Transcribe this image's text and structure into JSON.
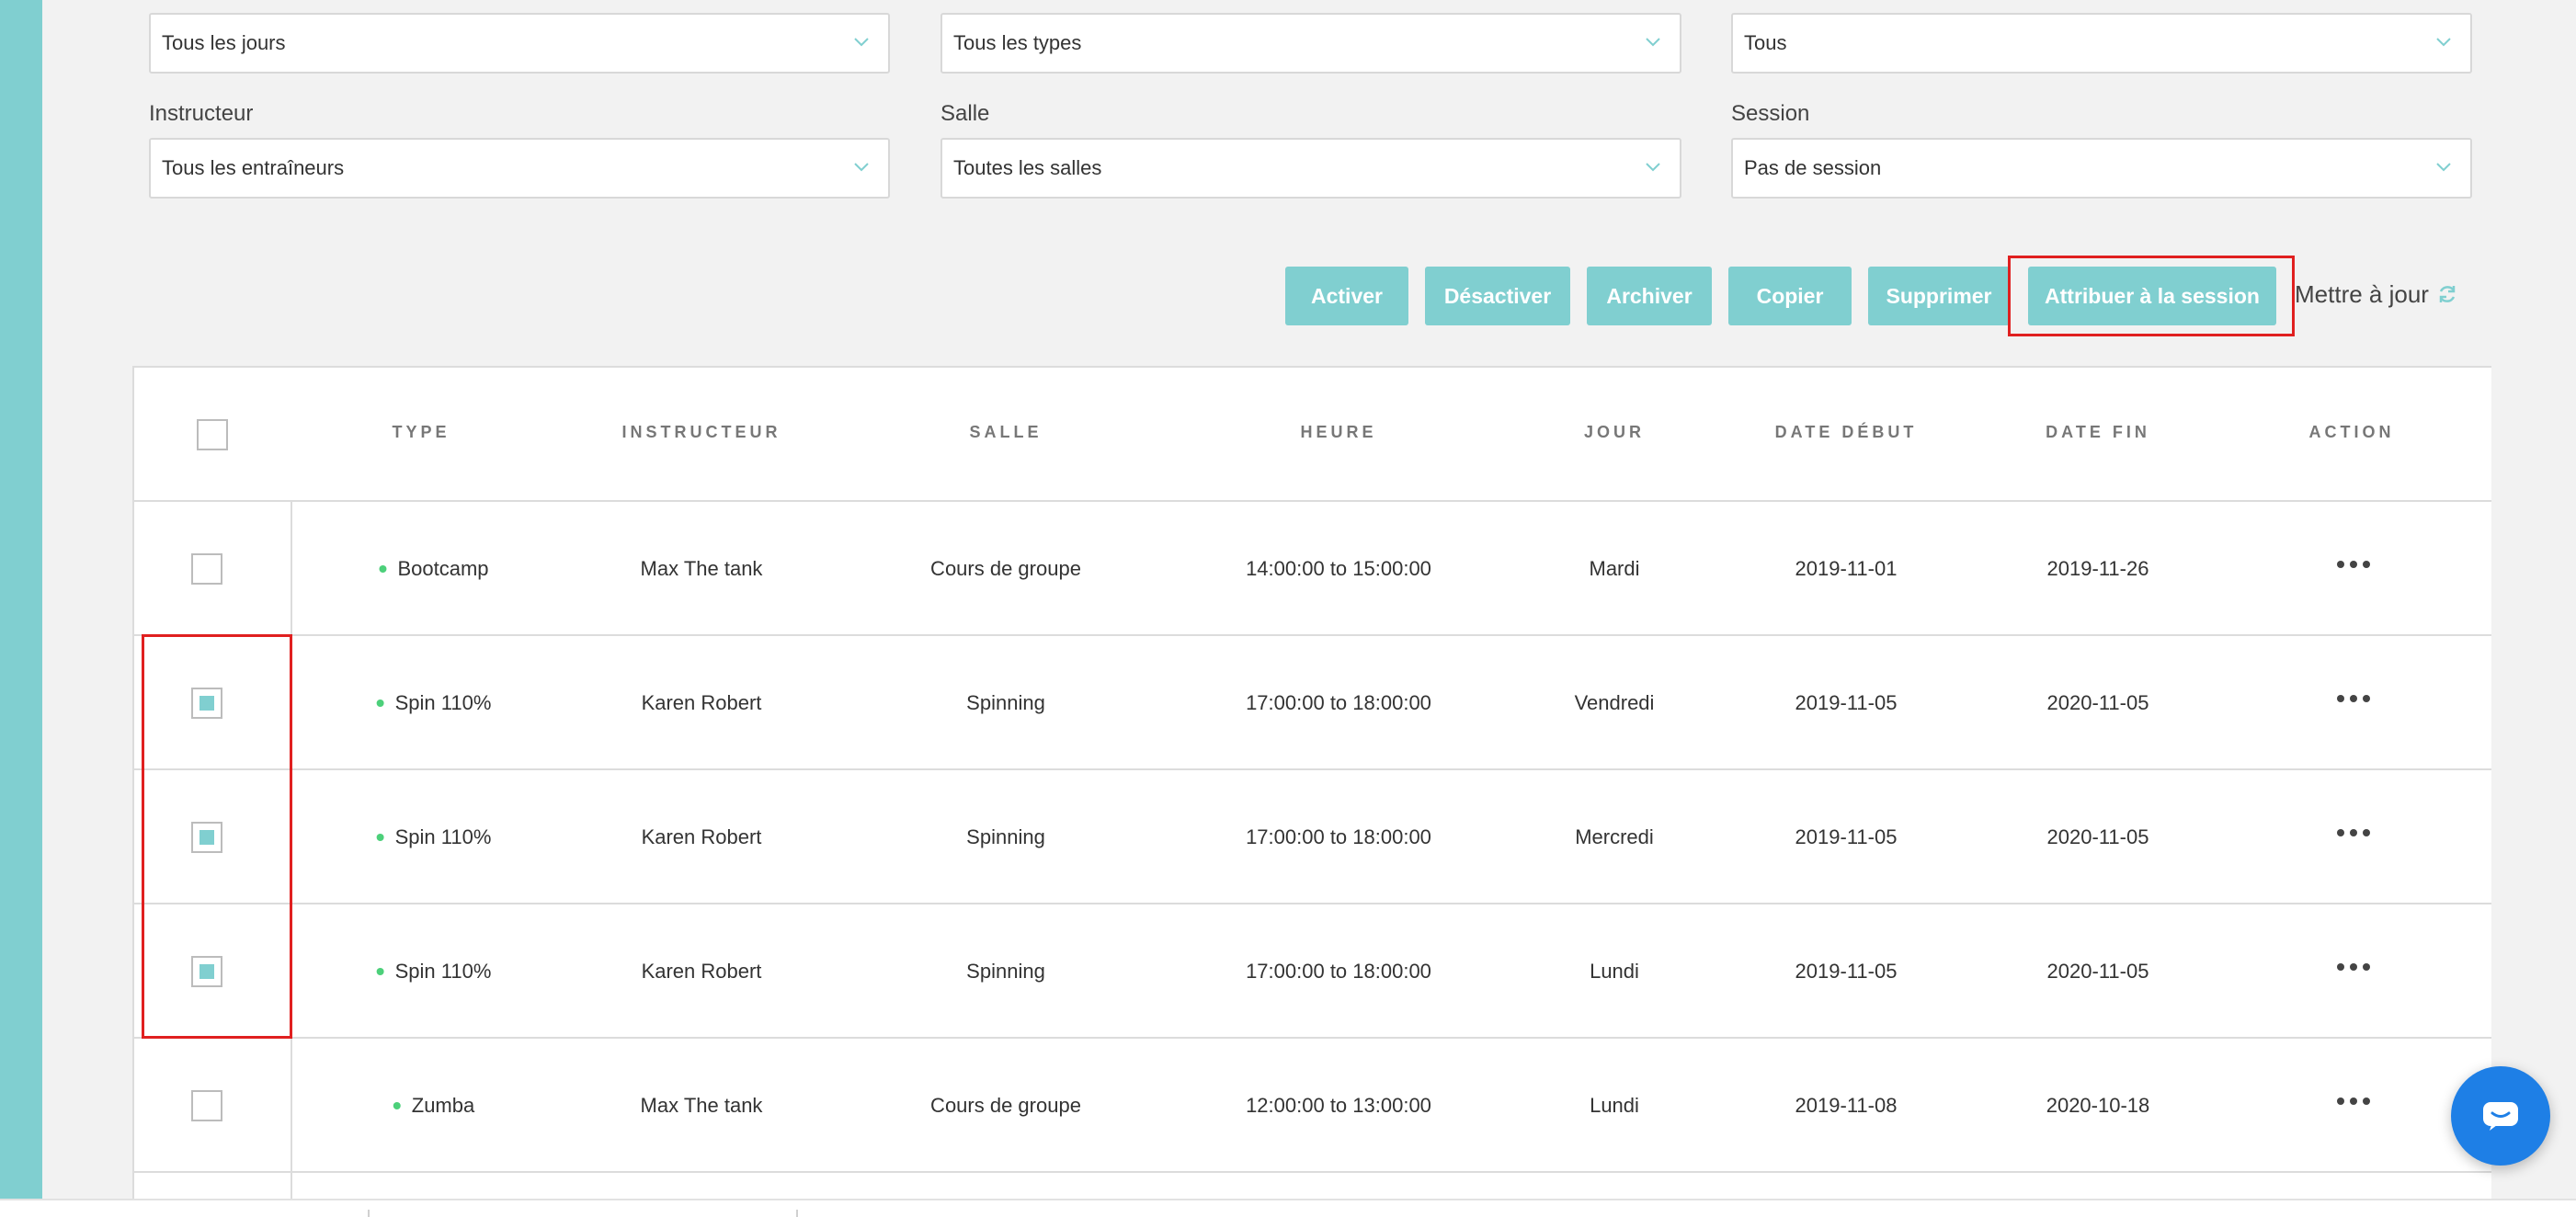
{
  "filters": {
    "day": {
      "value": "Tous les jours"
    },
    "type": {
      "value": "Tous les types"
    },
    "status": {
      "value": "Tous"
    },
    "instructor": {
      "label": "Instructeur",
      "value": "Tous les entraîneurs"
    },
    "room": {
      "label": "Salle",
      "value": "Toutes les salles"
    },
    "session": {
      "label": "Session",
      "value": "Pas de session"
    }
  },
  "actions": {
    "activate": "Activer",
    "deactivate": "Désactiver",
    "archive": "Archiver",
    "copy": "Copier",
    "delete": "Supprimer",
    "assign_session": "Attribuer à la session",
    "refresh": "Mettre à jour"
  },
  "table": {
    "columns": [
      "TYPE",
      "INSTRUCTEUR",
      "SALLE",
      "HEURE",
      "JOUR",
      "DATE DÉBUT",
      "DATE FIN",
      "ACTION"
    ],
    "rows": [
      {
        "type": "Bootcamp",
        "instructor": "Max The tank",
        "room": "Cours de groupe",
        "time": "14:00:00 to 15:00:00",
        "day": "Mardi",
        "start": "2019-11-01",
        "end": "2019-11-26",
        "checked": false
      },
      {
        "type": "Spin 110%",
        "instructor": "Karen Robert",
        "room": "Spinning",
        "time": "17:00:00 to 18:00:00",
        "day": "Vendredi",
        "start": "2019-11-05",
        "end": "2020-11-05",
        "checked": true
      },
      {
        "type": "Spin 110%",
        "instructor": "Karen Robert",
        "room": "Spinning",
        "time": "17:00:00 to 18:00:00",
        "day": "Mercredi",
        "start": "2019-11-05",
        "end": "2020-11-05",
        "checked": true
      },
      {
        "type": "Spin 110%",
        "instructor": "Karen Robert",
        "room": "Spinning",
        "time": "17:00:00 to 18:00:00",
        "day": "Lundi",
        "start": "2019-11-05",
        "end": "2020-11-05",
        "checked": true
      },
      {
        "type": "Zumba",
        "instructor": "Max The tank",
        "room": "Cours de groupe",
        "time": "12:00:00 to 13:00:00",
        "day": "Lundi",
        "start": "2019-11-08",
        "end": "2020-10-18",
        "checked": false
      }
    ]
  },
  "colors": {
    "accent": "#80cfd0",
    "active_dot": "#4cd07a",
    "highlight": "#e02020",
    "chat": "#1e7fe6"
  },
  "icons": {
    "select_chevron": "chevron-down-icon",
    "refresh": "refresh-icon",
    "row_actions": "more-horizontal-icon",
    "chat": "chat-icon"
  }
}
